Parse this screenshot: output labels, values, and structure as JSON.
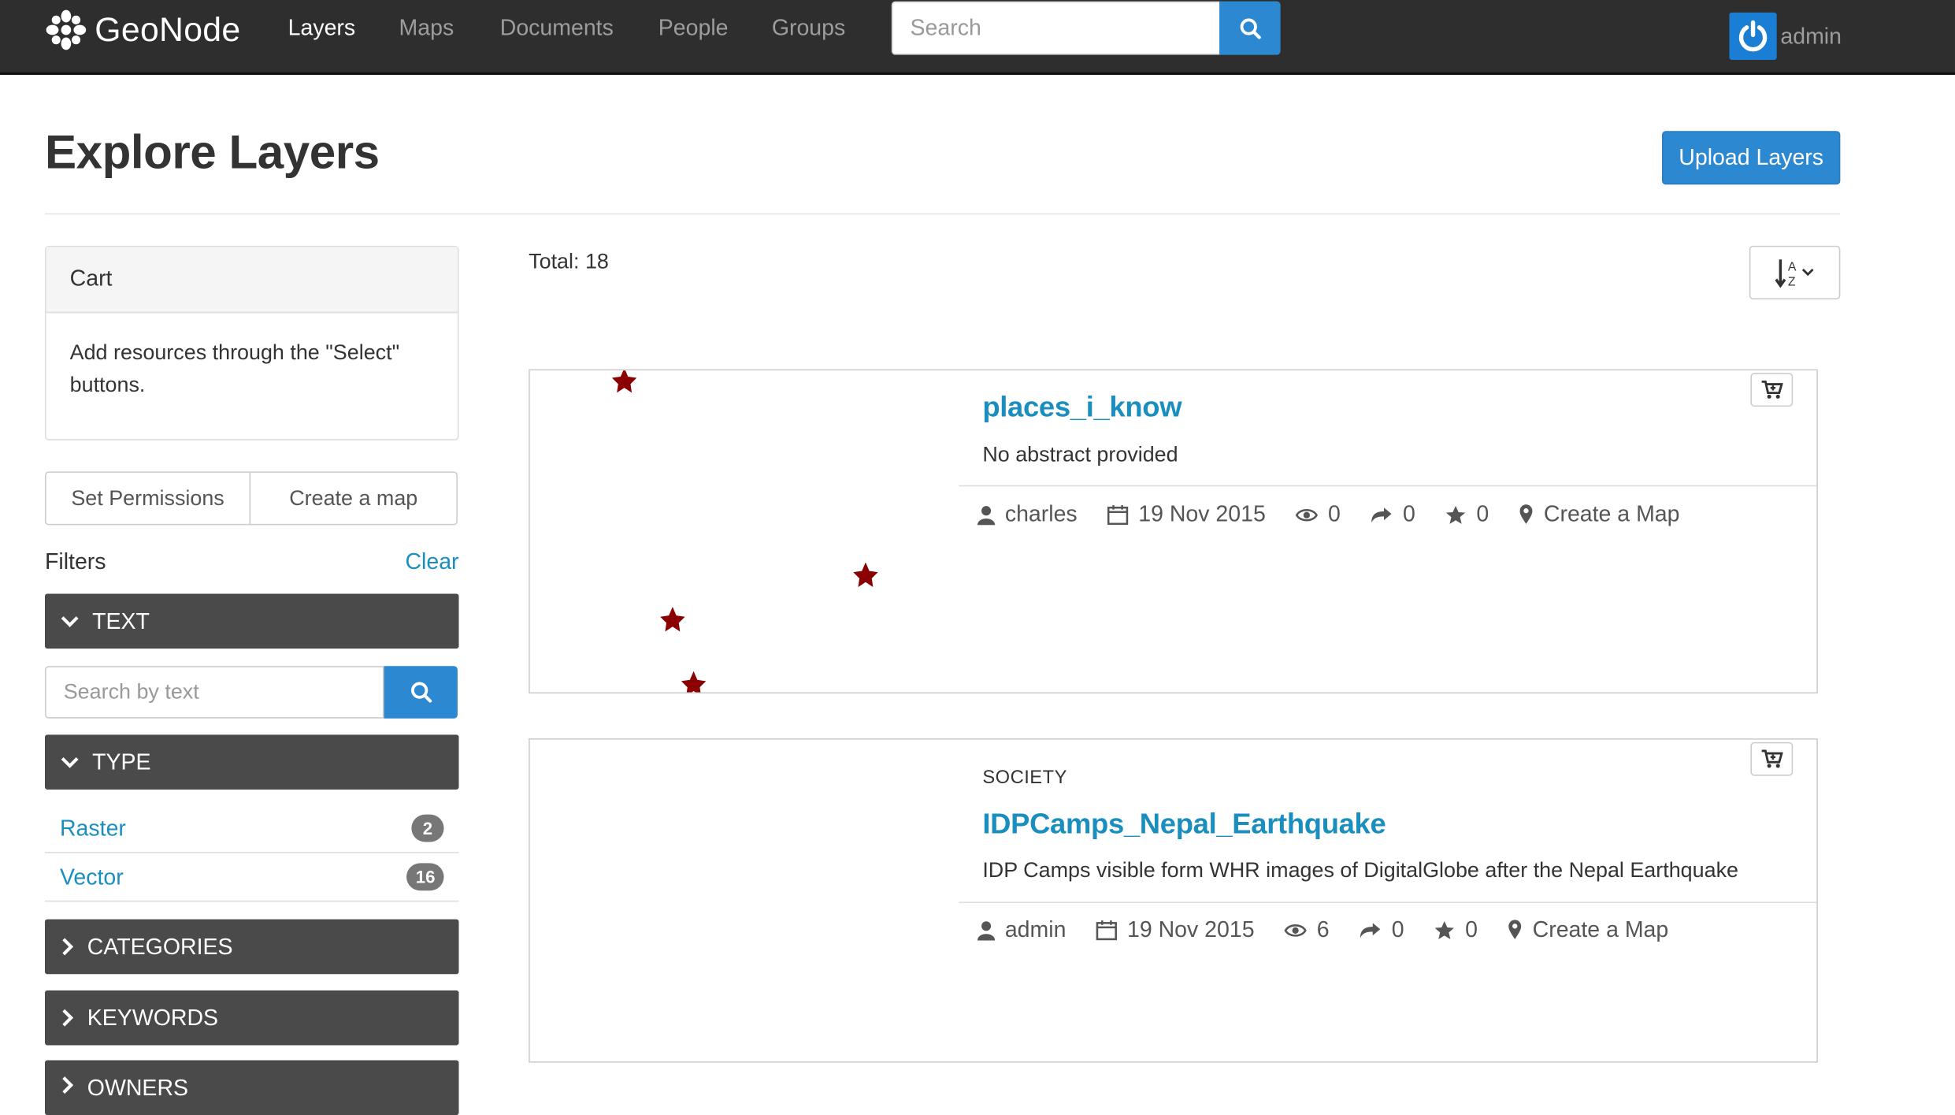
{
  "brand": {
    "name": "GeoNode"
  },
  "nav": {
    "items": [
      {
        "label": "Layers",
        "active": true
      },
      {
        "label": "Maps"
      },
      {
        "label": "Documents"
      },
      {
        "label": "People"
      },
      {
        "label": "Groups"
      }
    ],
    "search_placeholder": "Search",
    "user_name": "admin"
  },
  "page": {
    "title": "Explore Layers",
    "upload_label": "Upload Layers"
  },
  "sidebar": {
    "cart_title": "Cart",
    "cart_body": "Add resources through the \"Select\" buttons.",
    "set_permissions_label": "Set Permissions",
    "create_map_label": "Create a map",
    "filters_label": "Filters",
    "clear_label": "Clear",
    "facets": {
      "text": "TEXT",
      "type": "TYPE",
      "categories": "CATEGORIES",
      "keywords": "KEYWORDS",
      "owners": "OWNERS"
    },
    "text_search_placeholder": "Search by text",
    "types": [
      {
        "label": "Raster",
        "count": "2"
      },
      {
        "label": "Vector",
        "count": "16"
      }
    ]
  },
  "results": {
    "total_label": "Total: 18",
    "cards": [
      {
        "category": "",
        "title": "places_i_know",
        "abstract": "No abstract provided",
        "owner": "charles",
        "date": "19 Nov 2015",
        "views": "0",
        "shares": "0",
        "rating": "0",
        "create_map_label": "Create a Map"
      },
      {
        "category": "SOCIETY",
        "title": "IDPCamps_Nepal_Earthquake",
        "abstract": "IDP Camps visible form WHR images of DigitalGlobe after the Nepal Earthquake",
        "owner": "admin",
        "date": "19 Nov 2015",
        "views": "6",
        "shares": "0",
        "rating": "0",
        "create_map_label": "Create a Map"
      }
    ]
  },
  "colors": {
    "navbar": "#2e2e2e",
    "accent": "#2c88d0",
    "link": "#1a8fbf",
    "facet": "#4a4a4a",
    "marker": "#8b0000"
  }
}
